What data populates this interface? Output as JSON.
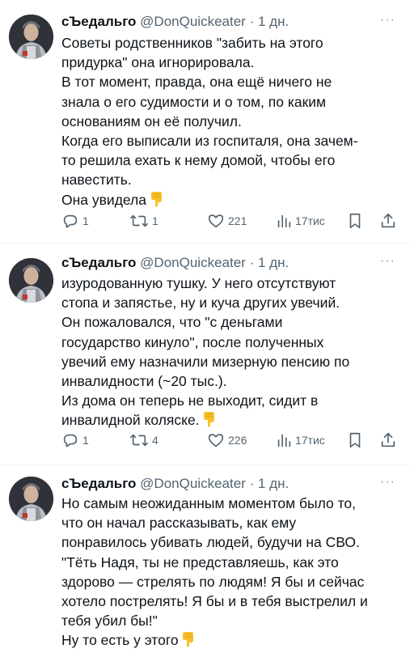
{
  "tweets": [
    {
      "author_name": "сЪедальго",
      "author_handle": "@DonQuickeater",
      "separator": "·",
      "time": "1 дн.",
      "more_label": "···",
      "lines": [
        "Советы родственников \"забить на этого",
        "придурка\" она игнорировала.",
        "В тот момент, правда, она ещё ничего не",
        "знала о его судимости и о том, по каким",
        "основаниям он её получил.",
        "Когда его выписали из госпиталя, она зачем-",
        "то решила ехать к нему домой, чтобы его",
        "навестить.",
        "Она увидела"
      ],
      "replies": "1",
      "reposts": "1",
      "likes": "221",
      "views": "17тис"
    },
    {
      "author_name": "сЪедальго",
      "author_handle": "@DonQuickeater",
      "separator": "·",
      "time": "1 дн.",
      "more_label": "···",
      "lines": [
        "изуродованную тушку. У него отсутствуют",
        "стопа и запястье, ну и куча других увечий.",
        "Он пожаловался, что \"с деньгами",
        "государство кинуло\", после полученных",
        "увечий ему назначили мизерную пенсию по",
        "инвалидности (~20 тыс.).",
        "Из дома он теперь не выходит, сидит в",
        "инвалидной коляске."
      ],
      "replies": "1",
      "reposts": "4",
      "likes": "226",
      "views": "17тис"
    },
    {
      "author_name": "сЪедальго",
      "author_handle": "@DonQuickeater",
      "separator": "·",
      "time": "1 дн.",
      "more_label": "···",
      "lines": [
        "Но самым неожиданным моментом было то,",
        "что он начал рассказывать, как ему",
        "понравилось убивать людей, будучи на СВО.",
        "\"Тёть Надя, ты не представляешь, как это",
        "здорово — стрелять по людям! Я бы и сейчас",
        "хотело пострелять! Я бы и в тебя выстрелил и",
        "тебя убил бы!\"",
        "Ну то есть у этого"
      ]
    }
  ],
  "colors": {
    "text": "#0f1419",
    "secondary": "#536471",
    "divider": "#eff3f4",
    "emoji": "#f7c02b"
  },
  "icons": [
    "reply-icon",
    "repost-icon",
    "like-icon",
    "views-icon",
    "bookmark-icon",
    "share-icon",
    "pointing-down-emoji"
  ]
}
